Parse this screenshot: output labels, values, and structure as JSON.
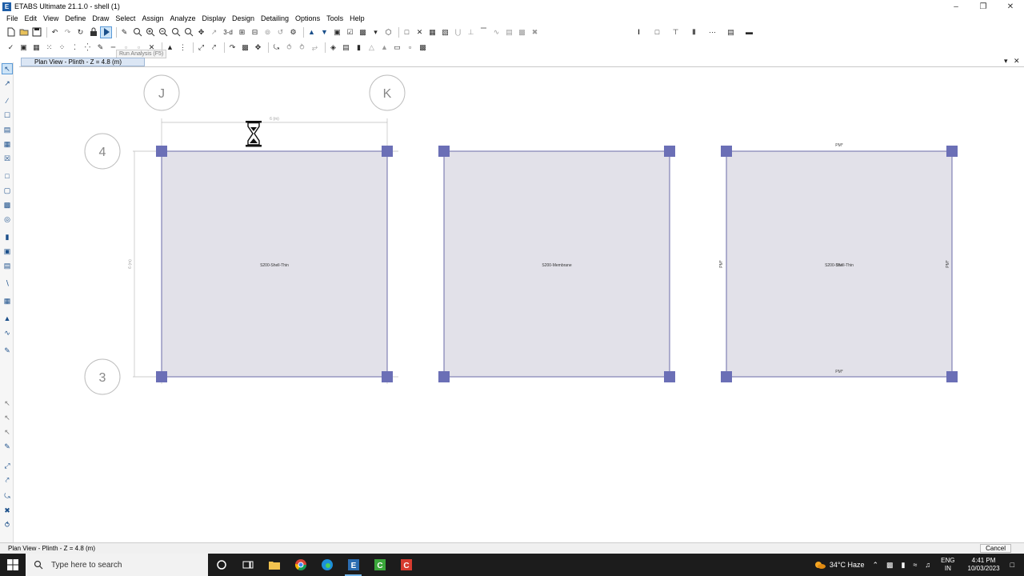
{
  "window": {
    "app_badge": "E",
    "title": "ETABS Ultimate 21.1.0 - shell (1)"
  },
  "menu": [
    "File",
    "Edit",
    "View",
    "Define",
    "Draw",
    "Select",
    "Assign",
    "Analyze",
    "Display",
    "Design",
    "Detailing",
    "Options",
    "Tools",
    "Help"
  ],
  "toolbar": {
    "view3d_label": "3-d",
    "tooltip": "Run Analysis (F5)"
  },
  "view": {
    "tab_label": "Plan View - Plinth - Z = 4.8 (m)"
  },
  "grids": {
    "columns": [
      "J",
      "K"
    ],
    "rows": [
      "4",
      "3"
    ],
    "dim_horizontal": "6 (m)",
    "dim_vertical": "6 (m)"
  },
  "panels": [
    {
      "label": "S200-Shell-Thin",
      "edge_labels": []
    },
    {
      "label": "S200-Membrane",
      "edge_labels": []
    },
    {
      "label": "S200-Shell-Thin",
      "overlay": "BM",
      "edge_labels": [
        "PM*",
        "PM*",
        "PM*",
        "PM*"
      ]
    }
  ],
  "colors": {
    "panel_fill": "#e2e1e9",
    "panel_edge": "#6a6aa8",
    "joint": "#6b6fb6",
    "grid_line": "#b8b8b8"
  },
  "status": {
    "text": "Plan View - Plinth - Z = 4.8 (m)",
    "cancel": "Cancel"
  },
  "taskbar": {
    "search_placeholder": "Type here to search",
    "weather": "34°C  Haze",
    "lang_top": "ENG",
    "lang_bottom": "IN",
    "time": "4:41 PM",
    "date": "10/03/2023"
  }
}
